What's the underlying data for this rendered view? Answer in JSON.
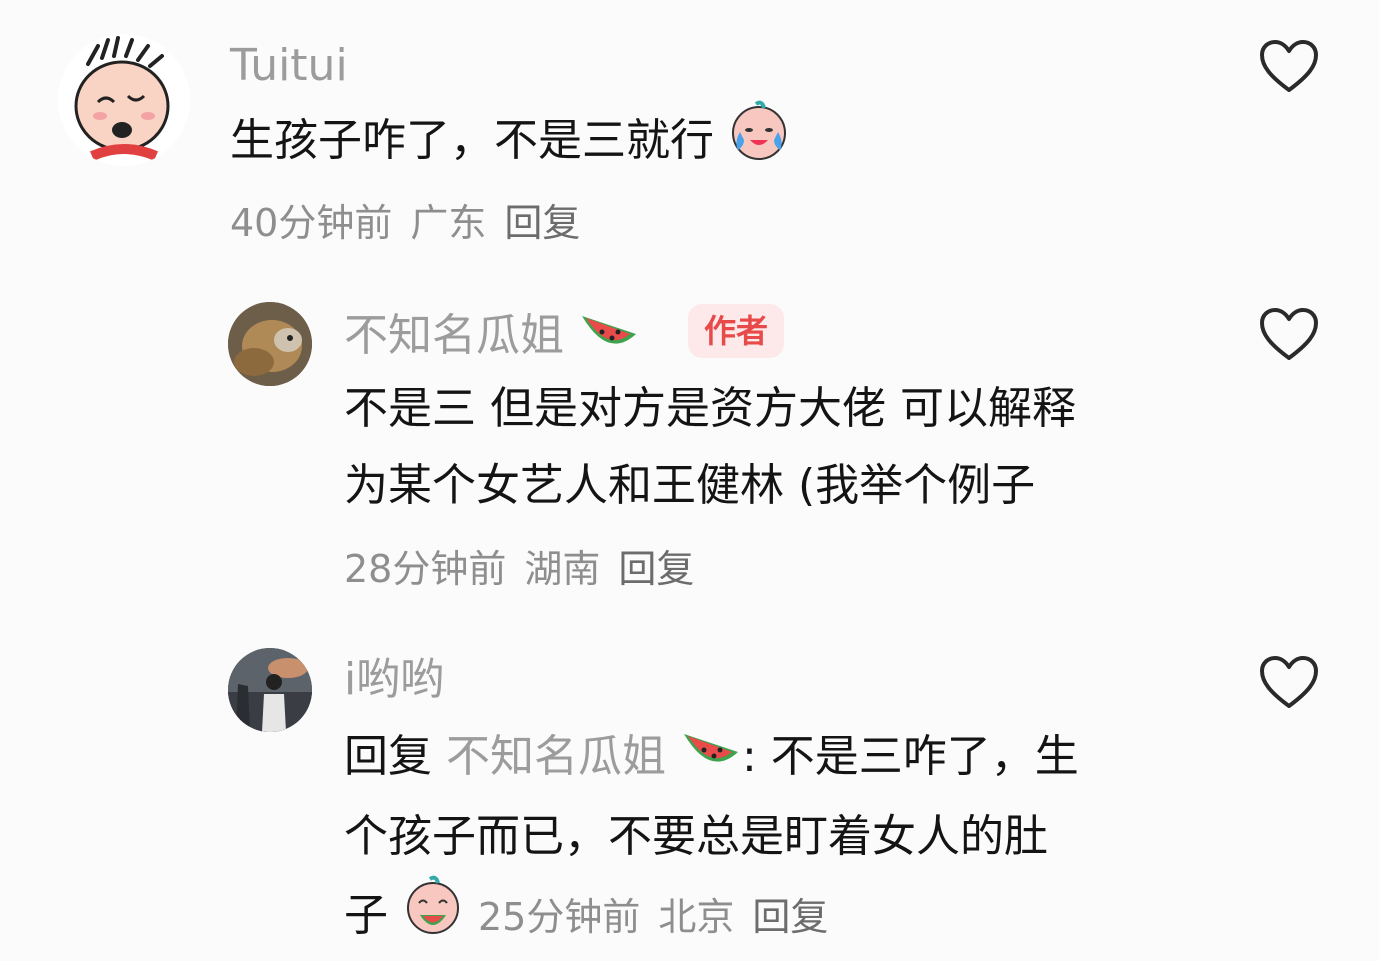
{
  "comments": [
    {
      "username": "Tuitui",
      "text": "生孩子咋了，不是三就行",
      "time": "40分钟前",
      "location": "广东",
      "reply_label": "回复"
    },
    {
      "username": "不知名瓜姐",
      "author_badge": "作者",
      "line1": "不是三 但是对方是资方大佬 可以解释",
      "line2": "为某个女艺人和王健林 (我举个例子",
      "time": "28分钟前",
      "location": "湖南",
      "reply_label": "回复"
    },
    {
      "username": "i哟哟",
      "reply_prefix": "回复",
      "reply_target": "不知名瓜姐",
      "line1_rest": ": 不是三咋了，生",
      "line2": "个孩子而已，不要总是盯着女人的肚",
      "line3_start": "子",
      "time": "25分钟前",
      "location": "北京",
      "reply_label": "回复"
    }
  ],
  "icons": {
    "like": "heart-outline-icon",
    "watermelon": "watermelon-emoji",
    "crying": "crying-face-emoji",
    "eating": "eating-watermelon-emoji"
  }
}
